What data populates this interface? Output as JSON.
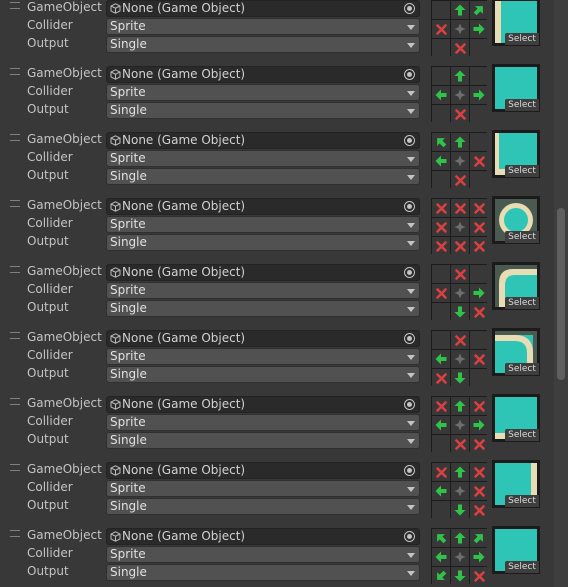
{
  "labels": {
    "gameobject": "GameObject",
    "collider": "Collider",
    "output": "Output"
  },
  "select_label": "Select",
  "colors": {
    "panel": "#383838",
    "arrow": "#2fc34a",
    "cross": "#d94040",
    "center": "#6e6e6e",
    "tile_teal": "#2ec4b6",
    "tile_edge": "#e8dcb5"
  },
  "rules": [
    {
      "gameobject_value": "None (Game Object)",
      "collider_value": "Sprite",
      "output_value": "Single",
      "neighbors": [
        "",
        "arrow-n",
        "arrow-ne",
        "x",
        "center",
        "arrow-e",
        "",
        "x",
        ""
      ],
      "tile": "corner-tl"
    },
    {
      "gameobject_value": "None (Game Object)",
      "collider_value": "Sprite",
      "output_value": "Single",
      "neighbors": [
        "",
        "arrow-n",
        "",
        "arrow-w",
        "center",
        "arrow-e",
        "",
        "x",
        ""
      ],
      "tile": "edge-top"
    },
    {
      "gameobject_value": "None (Game Object)",
      "collider_value": "Sprite",
      "output_value": "Single",
      "neighbors": [
        "arrow-nw",
        "arrow-n",
        "",
        "arrow-w",
        "center",
        "x",
        "",
        "x",
        ""
      ],
      "tile": "corner-tr"
    },
    {
      "gameobject_value": "None (Game Object)",
      "collider_value": "Sprite",
      "output_value": "Single",
      "neighbors": [
        "x",
        "x",
        "x",
        "x",
        "center",
        "x",
        "x",
        "x",
        "x"
      ],
      "tile": "ring"
    },
    {
      "gameobject_value": "None (Game Object)",
      "collider_value": "Sprite",
      "output_value": "Single",
      "neighbors": [
        "",
        "x",
        "",
        "x",
        "center",
        "arrow-e",
        "",
        "arrow-s",
        "x"
      ],
      "tile": "outer-corner-tl"
    },
    {
      "gameobject_value": "None (Game Object)",
      "collider_value": "Sprite",
      "output_value": "Single",
      "neighbors": [
        "",
        "x",
        "",
        "arrow-w",
        "center",
        "x",
        "x",
        "arrow-s",
        ""
      ],
      "tile": "outer-corner-tr"
    },
    {
      "gameobject_value": "None (Game Object)",
      "collider_value": "Sprite",
      "output_value": "Single",
      "neighbors": [
        "x",
        "arrow-n",
        "x",
        "arrow-w",
        "center",
        "arrow-e",
        "",
        "x",
        "x"
      ],
      "tile": "inner-bottom"
    },
    {
      "gameobject_value": "None (Game Object)",
      "collider_value": "Sprite",
      "output_value": "Single",
      "neighbors": [
        "x",
        "arrow-n",
        "x",
        "arrow-w",
        "center",
        "x",
        "",
        "arrow-s",
        "x"
      ],
      "tile": "inner-right"
    },
    {
      "gameobject_value": "None (Game Object)",
      "collider_value": "Sprite",
      "output_value": "Single",
      "neighbors": [
        "arrow-nw",
        "arrow-n",
        "arrow-ne",
        "arrow-w",
        "center",
        "arrow-e",
        "arrow-sw",
        "arrow-s",
        "x"
      ],
      "tile": "fill-corner"
    }
  ]
}
